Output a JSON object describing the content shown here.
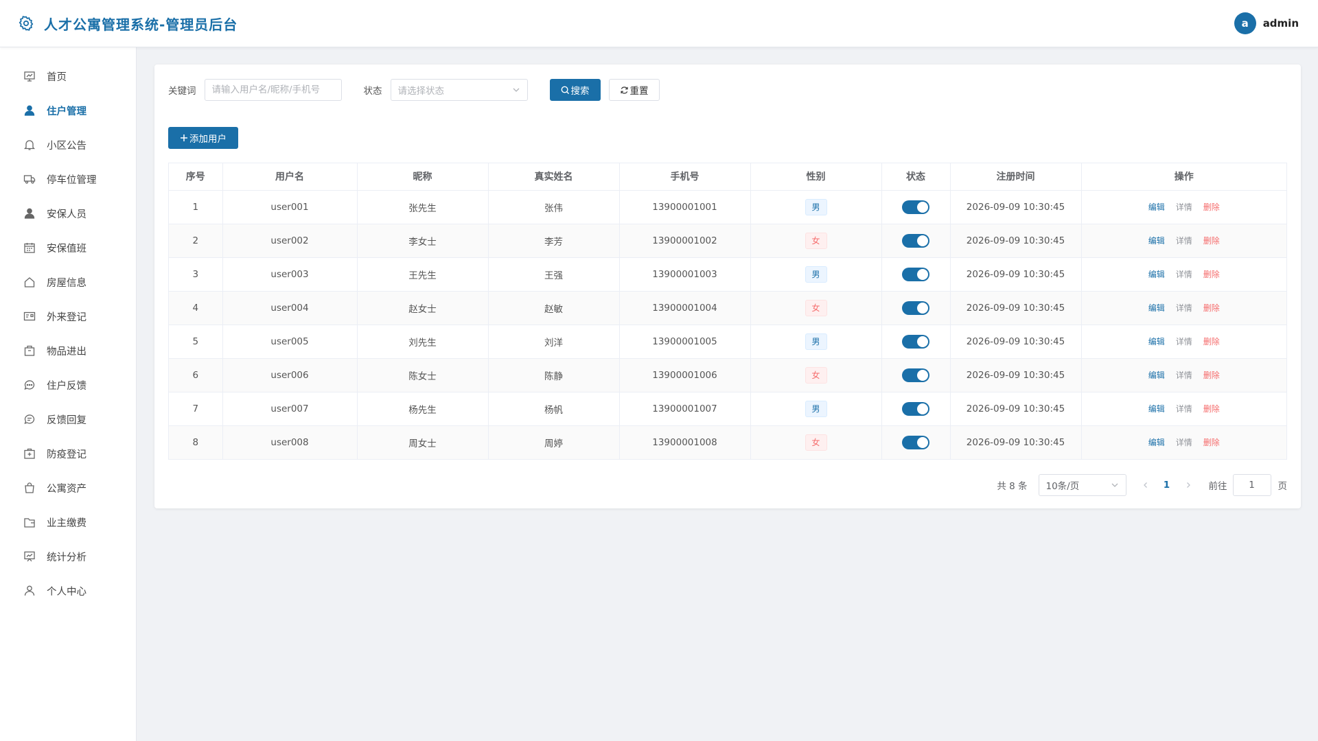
{
  "header": {
    "title": "人才公寓管理系统-管理员后台",
    "avatar_letter": "a",
    "username": "admin"
  },
  "sidebar": {
    "items": [
      {
        "label": "首页",
        "icon": "dashboard-icon"
      },
      {
        "label": "住户管理",
        "icon": "user-filled-icon",
        "active": true
      },
      {
        "label": "小区公告",
        "icon": "bell-icon"
      },
      {
        "label": "停车位管理",
        "icon": "van-icon"
      },
      {
        "label": "安保人员",
        "icon": "avatar-icon"
      },
      {
        "label": "安保值班",
        "icon": "calendar-icon"
      },
      {
        "label": "房屋信息",
        "icon": "house-icon"
      },
      {
        "label": "外来登记",
        "icon": "postcard-icon"
      },
      {
        "label": "物品进出",
        "icon": "box-icon"
      },
      {
        "label": "住户反馈",
        "icon": "chat-dots-icon"
      },
      {
        "label": "反馈回复",
        "icon": "chat-line-icon"
      },
      {
        "label": "防疫登记",
        "icon": "first-aid-icon"
      },
      {
        "label": "公寓资产",
        "icon": "shopping-bag-icon"
      },
      {
        "label": "业主缴费",
        "icon": "wallet-icon"
      },
      {
        "label": "统计分析",
        "icon": "data-board-icon"
      },
      {
        "label": "个人中心",
        "icon": "user-icon"
      }
    ]
  },
  "search": {
    "keyword_label": "关键词",
    "keyword_placeholder": "请输入用户名/昵称/手机号",
    "status_label": "状态",
    "status_placeholder": "请选择状态",
    "search_button": "搜索",
    "reset_button": "重置"
  },
  "toolbar": {
    "add_button": "添加用户"
  },
  "table": {
    "columns": [
      "序号",
      "用户名",
      "昵称",
      "真实姓名",
      "手机号",
      "性别",
      "状态",
      "注册时间",
      "操作"
    ],
    "rows": [
      {
        "index": "1",
        "username": "user001",
        "nickname": "张先生",
        "realname": "张伟",
        "phone": "13900001001",
        "gender": "男",
        "gender_type": "male",
        "status_on": true,
        "registered": "2026-09-09 10:30:45"
      },
      {
        "index": "2",
        "username": "user002",
        "nickname": "李女士",
        "realname": "李芳",
        "phone": "13900001002",
        "gender": "女",
        "gender_type": "female",
        "status_on": true,
        "registered": "2026-09-09 10:30:45"
      },
      {
        "index": "3",
        "username": "user003",
        "nickname": "王先生",
        "realname": "王强",
        "phone": "13900001003",
        "gender": "男",
        "gender_type": "male",
        "status_on": true,
        "registered": "2026-09-09 10:30:45"
      },
      {
        "index": "4",
        "username": "user004",
        "nickname": "赵女士",
        "realname": "赵敏",
        "phone": "13900001004",
        "gender": "女",
        "gender_type": "female",
        "status_on": true,
        "registered": "2026-09-09 10:30:45"
      },
      {
        "index": "5",
        "username": "user005",
        "nickname": "刘先生",
        "realname": "刘洋",
        "phone": "13900001005",
        "gender": "男",
        "gender_type": "male",
        "status_on": true,
        "registered": "2026-09-09 10:30:45"
      },
      {
        "index": "6",
        "username": "user006",
        "nickname": "陈女士",
        "realname": "陈静",
        "phone": "13900001006",
        "gender": "女",
        "gender_type": "female",
        "status_on": true,
        "registered": "2026-09-09 10:30:45"
      },
      {
        "index": "7",
        "username": "user007",
        "nickname": "杨先生",
        "realname": "杨帆",
        "phone": "13900001007",
        "gender": "男",
        "gender_type": "male",
        "status_on": true,
        "registered": "2026-09-09 10:30:45"
      },
      {
        "index": "8",
        "username": "user008",
        "nickname": "周女士",
        "realname": "周婷",
        "phone": "13900001008",
        "gender": "女",
        "gender_type": "female",
        "status_on": true,
        "registered": "2026-09-09 10:30:45"
      }
    ],
    "actions": {
      "edit": "编辑",
      "detail": "详情",
      "delete": "删除"
    }
  },
  "pagination": {
    "total_text": "共 8 条",
    "page_size": "10条/页",
    "current_page": "1",
    "goto_label": "前往",
    "goto_value": "1",
    "page_suffix": "页"
  },
  "colors": {
    "primary": "#1a6fa8",
    "danger": "#f56c6c",
    "info": "#909399"
  }
}
